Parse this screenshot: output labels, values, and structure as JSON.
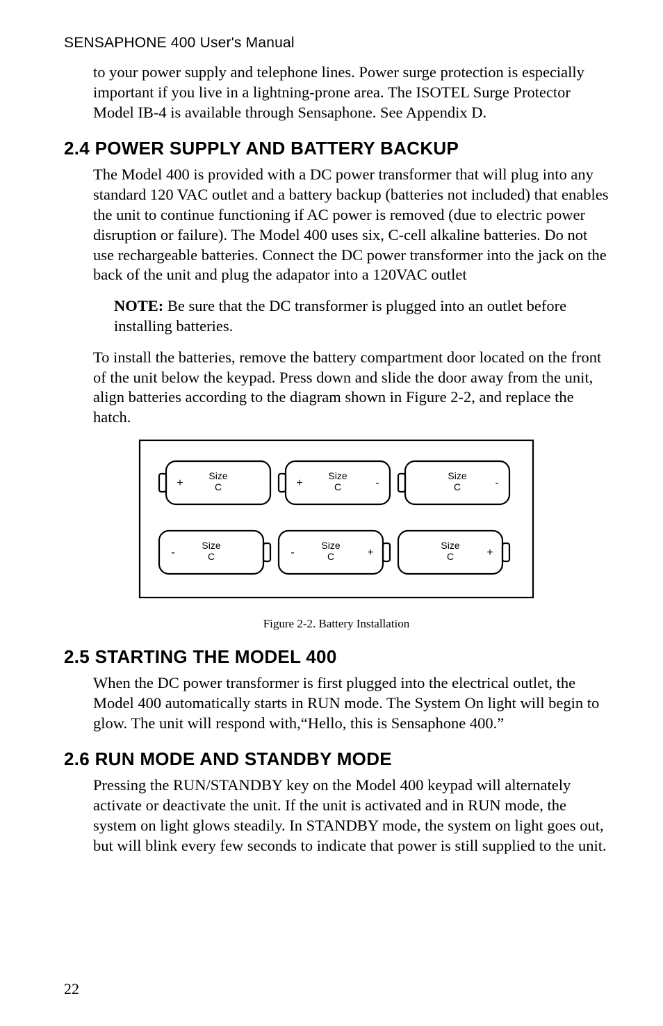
{
  "running_head": "SENSAPHONE 400 User's Manual",
  "intro_para": "to your power supply and telephone lines. Power surge protection is especially important if you live in a lightning-prone area. The ISOTEL Surge Protector Model IB-4 is available through Sensaphone. See Appendix D.",
  "s24": {
    "heading": "2.4 POWER SUPPLY AND BATTERY BACKUP",
    "p1": "The Model 400 is provided with a DC power transformer that will plug into any standard 120 VAC outlet and a battery backup (batteries not included) that enables the unit to continue functioning if AC power is removed (due to electric power disruption or failure). The Model 400 uses six, C-cell alkaline batteries. Do not use rechargeable batteries. Connect the DC power transformer into the jack on the back of the unit and plug the adapator into a 120VAC outlet",
    "note_label": "NOTE:",
    "note_body": " Be sure that the DC transformer is plugged into an outlet before installing batteries.",
    "p2": "To install the batteries, remove the battery compartment door located on the front of the unit below the keypad. Press down and slide the door away from the unit, align batteries according to the diagram shown in Figure 2-2, and replace the hatch."
  },
  "figure_caption": "Figure 2-2. Battery Installation",
  "s25": {
    "heading": "2.5 STARTING THE MODEL 400",
    "p1": "When the DC power transformer is first plugged into the electrical outlet, the Model 400 automatically starts in RUN mode. The System On light will begin to glow. The unit will respond with,“Hello, this is Sensaphone 400.”"
  },
  "s26": {
    "heading": "2.6 RUN MODE AND STANDBY MODE",
    "p1": "Pressing the RUN/STANDBY key on the Model 400 keypad will alternately activate or deactivate the unit. If the unit is activated and in RUN mode, the system on light glows steadily. In STANDBY mode, the system on light goes out, but will blink every few seconds to indicate that power is still supplied to the unit."
  },
  "page_number": "22",
  "battery": {
    "size_top": "Size",
    "size_bottom": "C",
    "plus": "+",
    "minus": "-"
  }
}
